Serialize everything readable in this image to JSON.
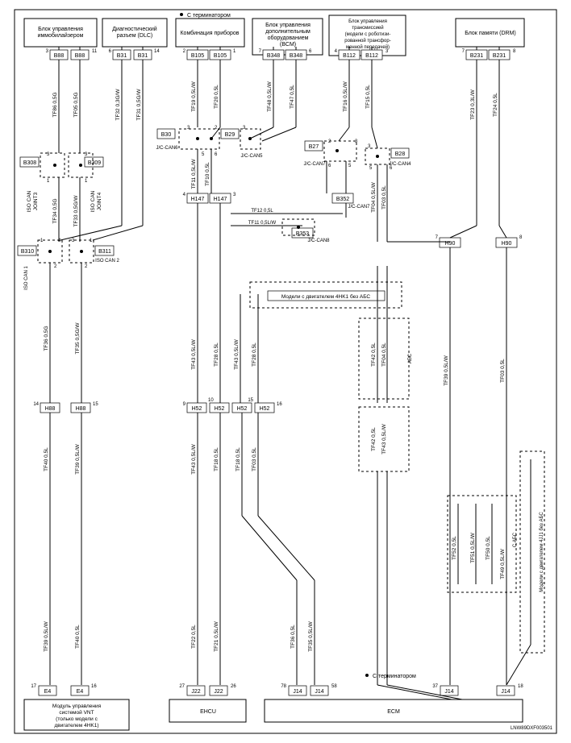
{
  "doc_id": "LNW89DXF003501",
  "terminator_top": "С терминатором",
  "terminator_bottom": "С терминатором",
  "modules": {
    "immo": "Блок управления\nиммобилайзером",
    "diag": "Диагностический\nразъем (DLC)",
    "cluster": "Комбинация приборов",
    "bcm": "Блок управления\nдополнительным\nоборудованием\n(BCM)",
    "tcm": "Блок управления\nтрансмиссией\n(модели с роботизи-\nрованной трансфор-\nменной передачей)",
    "drm": "Блок памяти (DRM)",
    "vnt": "Модуль управления\nсистемой VNT\n(только модели с\nдвигателем 4HK1)",
    "ehcu": "EHCU",
    "ecm": "ECM"
  },
  "annotations": {
    "abs_4hk1": "Модели с двигателем 4HK1 без АБС",
    "abs_4jj1": "Модели с двигателем 4JJ1 без АБС",
    "abs": "АБС",
    "c_abs": "С АБС"
  },
  "connectors": {
    "B88": "B88",
    "B31": "B31",
    "B105": "B105",
    "B348": "B348",
    "B112": "B112",
    "B231": "B231",
    "B308": "B308",
    "B309": "B309",
    "B310": "B310",
    "B311": "B311",
    "B30": "B30",
    "B29": "B29",
    "B27": "B27",
    "B28": "B28",
    "B352": "B352",
    "B353": "B353",
    "H147": "H147",
    "H90": "H90",
    "H88": "H88",
    "H52": "H52",
    "E4": "E4",
    "J22": "J22",
    "J14": "J14"
  },
  "joints": {
    "iso_can_joint3": "ISO CAN\nJOINT3",
    "iso_can_joint4": "ISO CAN\nJOINT4",
    "iso_can_1": "ISO CAN 1",
    "iso_can_2": "ISO CAN 2",
    "jc_can5": "J/C-CAN5",
    "jc_can6": "J/C-CAN6",
    "jc_can7": "J/C-CAN7",
    "jc_can4": "J/C-CAN4",
    "jc_can8": "J/C-CAN8"
  },
  "wires": {
    "tf86": "TF86 0,5G",
    "tf05g": "TF05 0,5G",
    "tf32": "TF32 0,3G/W",
    "tf31": "TF31 0,5G/W",
    "tf19": "TF19 0,5L/W",
    "tf20": "TF20 0,5L",
    "tf48": "TF48 0,5L/W",
    "tf47": "TF47 0,5L",
    "tf16": "TF16 0,5L/W",
    "tf15": "TF15 0,5L",
    "tf23": "TF23 0,3L/W",
    "tf24": "TF24 0,5L",
    "tf34": "TF34 0,5G",
    "tf33": "TF33 0,5G/W",
    "tf11": "TF11 0,5L/W",
    "tf10": "TF10 0,5L",
    "tf04": "TF04 0,5L/W",
    "tf03": "TF03 0,5L",
    "tf36": "TF36 0,5G",
    "tf35": "TF35 0,5G/W",
    "tf43": "TF43 0,5L/W",
    "tf28": "TF28 0,5L",
    "tf42": "TF42 0,5L",
    "tf04b": "TF04 0,5L",
    "tf12": "TF12 0,5L",
    "tf11b": "TF11 0,5L/W",
    "tf18": "TF18 0,5L",
    "tf03b": "TF03 0,5L",
    "tf39": "TF39 0,5L/W",
    "tf40": "TF40 0,5L",
    "tf22": "TF22 0,5L",
    "tf21": "TF21 0,5L/W",
    "tf36b": "TF36 0,5L",
    "tf35b": "TF35 0,5L/W",
    "tf52": "TF52 0,5L",
    "tf51": "TF51 0,5L/W",
    "tf50": "TF50 0,5L",
    "tf49": "TF49 0,5L/W",
    "tf39b": "TF39 0,5L/W",
    "tf40b": "TF40 0,5L"
  },
  "pins": {
    "p1": "1",
    "p2": "2",
    "p3": "3",
    "p4": "4",
    "p5": "5",
    "p6": "6",
    "p7": "7",
    "p8": "8",
    "p9": "9",
    "p10": "10",
    "p11": "11",
    "p14": "14",
    "p15": "15",
    "p16": "16",
    "p17": "17",
    "p18": "18",
    "p26": "26",
    "p27": "27",
    "p37": "37",
    "p58": "58",
    "p78": "78"
  }
}
